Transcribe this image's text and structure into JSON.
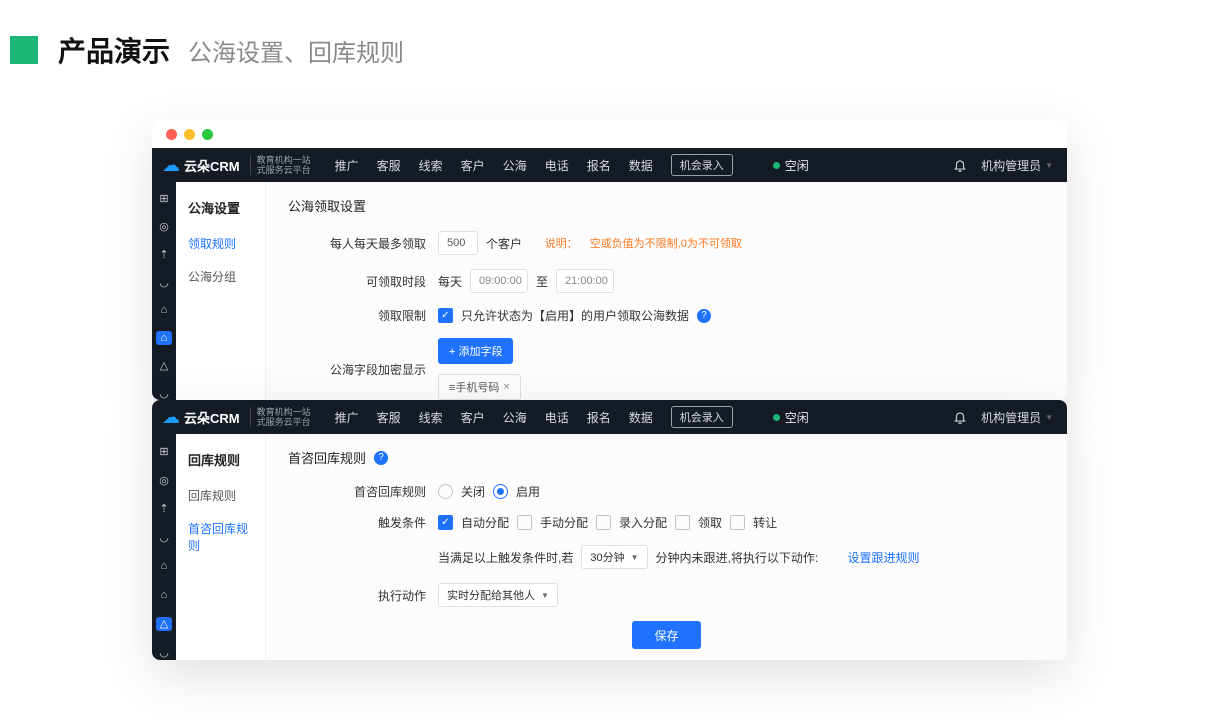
{
  "slide": {
    "title": "产品演示",
    "subtitle": "公海设置、回库规则"
  },
  "brand": {
    "name": "云朵CRM",
    "sub1": "教育机构一站",
    "sub2": "式服务云平台"
  },
  "nav": [
    "推广",
    "客服",
    "线索",
    "客户",
    "公海",
    "电话",
    "报名",
    "数据"
  ],
  "nav_pill": "机会录入",
  "status_text": "空闲",
  "user": "机构管理员",
  "win1": {
    "side_title": "公海设置",
    "side_items": [
      "领取规则",
      "公海分组"
    ],
    "content_title": "公海领取设置",
    "row1": {
      "label": "每人每天最多领取",
      "value": "500",
      "unit": "个客户",
      "note_prefix": "说明：",
      "note": "空或负值为不限制,0为不可领取"
    },
    "row2": {
      "label": "可领取时段",
      "prefix": "每天",
      "from": "09:00:00",
      "sep": "至",
      "to": "21:00:00"
    },
    "row3": {
      "label": "领取限制",
      "text": "只允许状态为【启用】的用户领取公海数据"
    },
    "row4": {
      "label": "公海字段加密显示",
      "btn": "+ 添加字段",
      "chip": "≡手机号码"
    }
  },
  "win2": {
    "side_title": "回库规则",
    "side_items": [
      "回库规则",
      "首咨回库规则"
    ],
    "content_title": "首咨回库规则",
    "row1": {
      "label": "首咨回库规则",
      "off": "关闭",
      "on": "启用"
    },
    "row2": {
      "label": "触发条件",
      "opts": [
        "自动分配",
        "手动分配",
        "录入分配",
        "领取",
        "转让"
      ]
    },
    "row3": {
      "prefix": "当满足以上触发条件时,若",
      "select": "30分钟",
      "mid": "分钟内未跟进,将执行以下动作:",
      "link": "设置跟进规则"
    },
    "row4": {
      "label": "执行动作",
      "select": "实时分配给其他人"
    },
    "save": "保存"
  }
}
